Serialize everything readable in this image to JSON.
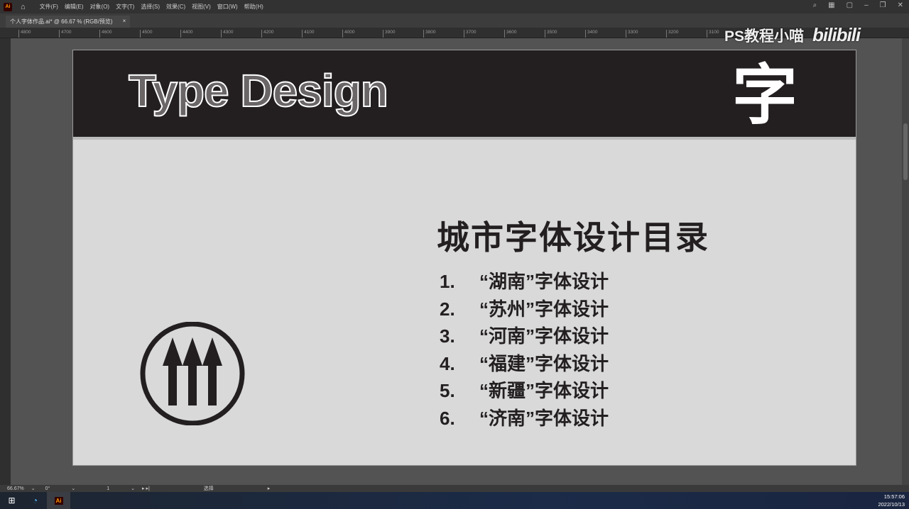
{
  "menubar": {
    "app_icon": "Ai",
    "items": [
      "文件(F)",
      "编辑(E)",
      "对象(O)",
      "文字(T)",
      "选择(S)",
      "效果(C)",
      "视图(V)",
      "窗口(W)",
      "帮助(H)"
    ]
  },
  "tab": {
    "title": "个人字体作品.ai* @ 66.67 % (RGB/预览)",
    "close": "×"
  },
  "ruler": [
    "4800",
    "4700",
    "4600",
    "4500",
    "4400",
    "4300",
    "4200",
    "4100",
    "4000",
    "3900",
    "3800",
    "3700",
    "3600",
    "3500",
    "3400",
    "3300",
    "3200",
    "3100"
  ],
  "artboard": {
    "header_title": "Type Design",
    "header_glyph": "字",
    "toc_title": "城市字体设计目录",
    "items": [
      {
        "num": "1.",
        "text": "“湖南”字体设计"
      },
      {
        "num": "2.",
        "text": "“苏州”字体设计"
      },
      {
        "num": "3.",
        "text": "“河南”字体设计"
      },
      {
        "num": "4.",
        "text": "“福建”字体设计"
      },
      {
        "num": "5.",
        "text": "“新疆”字体设计"
      },
      {
        "num": "6.",
        "text": "“济南”字体设计"
      }
    ]
  },
  "status": {
    "zoom": "66.67%",
    "rotation": "0°",
    "artboard_num": "1",
    "tool": "选择"
  },
  "watermark": {
    "channel": "PS教程小喵",
    "logo": "bilibili"
  },
  "taskbar": {
    "ai_label": "Ai",
    "time": "15:57:06",
    "date": "2022/10/13"
  }
}
